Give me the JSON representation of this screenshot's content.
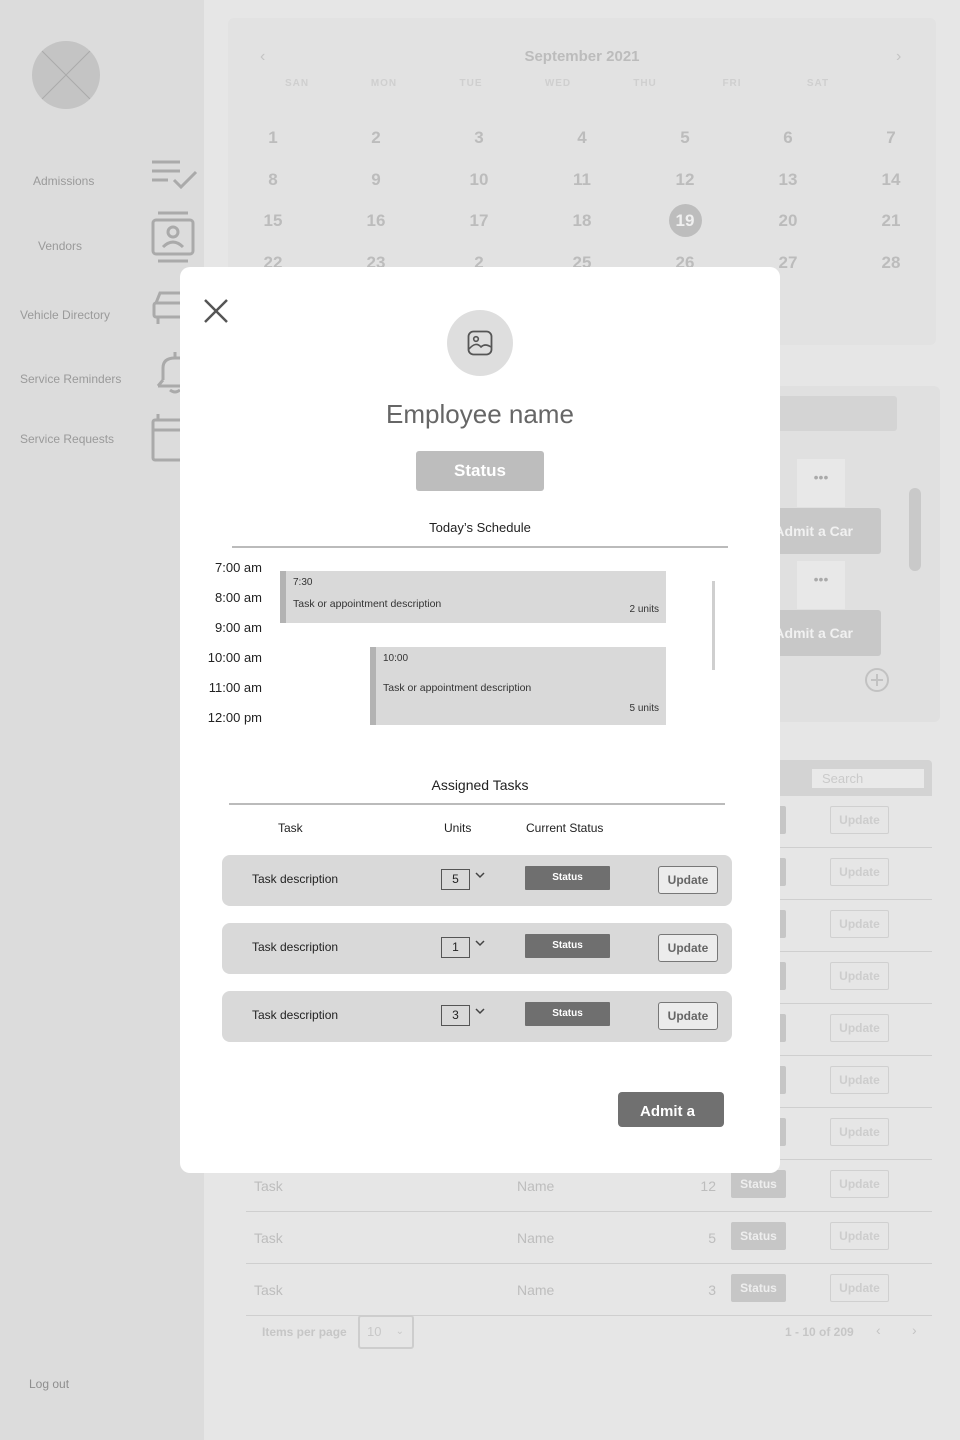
{
  "sidebar": {
    "items": [
      {
        "label": "Admissions",
        "icon": "checklist-icon"
      },
      {
        "label": "Vendors",
        "icon": "contact-card-icon"
      },
      {
        "label": "Vehicle Directory",
        "icon": "car-icon"
      },
      {
        "label": "Service Reminders",
        "icon": "bell-icon"
      },
      {
        "label": "Service Requests",
        "icon": "calendar-icon"
      }
    ],
    "logout_label": "Log out"
  },
  "calendar": {
    "month_label": "September 2021",
    "weekdays": [
      "SAN",
      "MON",
      "TUE",
      "WED",
      "THU",
      "FRI",
      "SAT"
    ],
    "weeks": [
      [
        "1",
        "2",
        "3",
        "4",
        "5",
        "6",
        "7"
      ],
      [
        "8",
        "9",
        "10",
        "11",
        "12",
        "13",
        "14"
      ],
      [
        "15",
        "16",
        "17",
        "18",
        "19",
        "20",
        "21"
      ],
      [
        "22",
        "23",
        "2",
        "25",
        "26",
        "27",
        "28"
      ]
    ],
    "selected_day": "19"
  },
  "admit_panel": {
    "admit_button_label": "Admit a Car",
    "more_label": "•••"
  },
  "table": {
    "search_placeholder": "Search",
    "rows": [
      {
        "task": "",
        "name": "",
        "units": "",
        "status": "",
        "update": "Update"
      },
      {
        "task": "",
        "name": "",
        "units": "",
        "status": "",
        "update": "Update"
      },
      {
        "task": "",
        "name": "",
        "units": "",
        "status": "",
        "update": "Update"
      },
      {
        "task": "",
        "name": "",
        "units": "",
        "status": "",
        "update": "Update"
      },
      {
        "task": "",
        "name": "",
        "units": "",
        "status": "",
        "update": "Update"
      },
      {
        "task": "",
        "name": "",
        "units": "",
        "status": "",
        "update": "Update"
      },
      {
        "task": "",
        "name": "",
        "units": "",
        "status": "",
        "update": "Update"
      },
      {
        "task": "Task",
        "name": "Name",
        "units": "12",
        "status": "Status",
        "update": "Update"
      },
      {
        "task": "Task",
        "name": "Name",
        "units": "5",
        "status": "Status",
        "update": "Update"
      },
      {
        "task": "Task",
        "name": "Name",
        "units": "3",
        "status": "Status",
        "update": "Update"
      }
    ],
    "items_per_page_label": "Items per page",
    "items_per_page_value": "10",
    "pagination_text": "1 - 10 of 209"
  },
  "modal": {
    "employee_name": "Employee name",
    "status_label": "Status",
    "schedule_title": "Today’s Schedule",
    "time_slots": [
      "7:00 am",
      "8:00 am",
      "9:00 am",
      "10:00 am",
      "11:00 am",
      "12:00 pm"
    ],
    "appointments": [
      {
        "time": "7:30",
        "description": "Task or appointment description",
        "units": "2 units"
      },
      {
        "time": "10:00",
        "description": "Task or appointment description",
        "units": "5 units"
      }
    ],
    "tasks_title": "Assigned Tasks",
    "columns": {
      "task": "Task",
      "units": "Units",
      "status": "Current Status"
    },
    "tasks": [
      {
        "description": "Task description",
        "units": "5",
        "status": "Status",
        "update": "Update"
      },
      {
        "description": "Task description",
        "units": "1",
        "status": "Status",
        "update": "Update"
      },
      {
        "description": "Task description",
        "units": "3",
        "status": "Status",
        "update": "Update"
      }
    ],
    "admit_button_label": "Admit a"
  }
}
